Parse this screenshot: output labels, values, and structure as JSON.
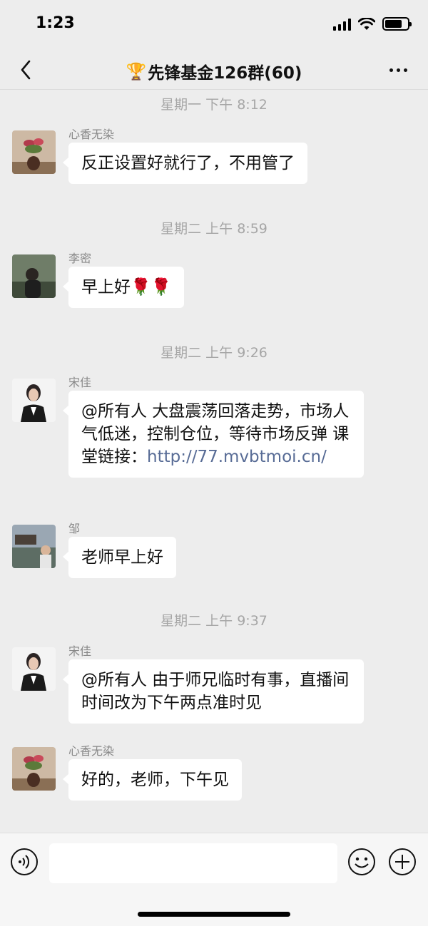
{
  "status_bar": {
    "time": "1:23"
  },
  "nav": {
    "title": "先锋基金126群(60)",
    "trophy_icon": "🏆"
  },
  "messages": [
    {
      "sender": "心香无染",
      "text": "反正设置好就行了，不用管了"
    },
    {
      "sender": "李密",
      "text": "早上好🌹🌹"
    },
    {
      "sender": "宋佳",
      "text": "@所有人 大盘震荡回落走势，市场人气低迷，控制仓位，等待市场反弹 课堂链接：",
      "link": "http://77.mvbtmoi.cn/"
    },
    {
      "sender": "邹",
      "text": "老师早上好"
    },
    {
      "sender": "宋佳",
      "text": "@所有人 由于师兄临时有事，直播间时间改为下午两点准时见"
    },
    {
      "sender": "心香无染",
      "text": "好的，老师，下午见"
    }
  ],
  "timestamps": [
    "星期一 下午 8:12",
    "星期二 上午 8:59",
    "星期二 上午 9:26",
    "星期二 上午 9:37"
  ],
  "input": {
    "placeholder": ""
  },
  "colors": {
    "background": "#ededed",
    "bubble": "#ffffff",
    "link": "#576b95",
    "timestamp": "#a6a6a6"
  }
}
